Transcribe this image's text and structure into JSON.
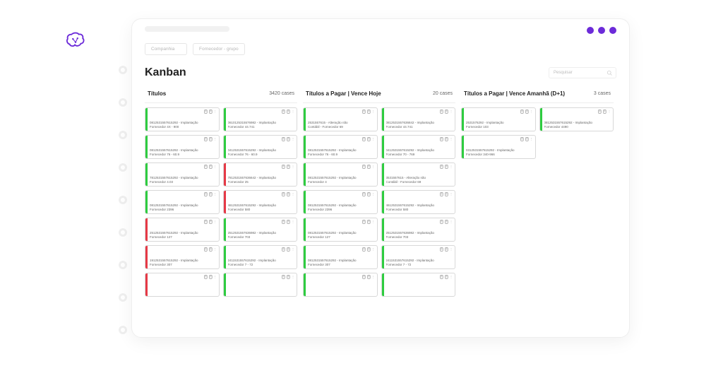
{
  "filters": {
    "companhia": "Companhia",
    "fornecedor": "Fornecedor - grupo"
  },
  "page_title": "Kanban",
  "search_placeholder": "Pesquisar",
  "columns": [
    {
      "title": "Títulos",
      "count": "3420 cases",
      "cards": [
        {
          "stripe": "green",
          "l1": "0812531557615292 - Implantação",
          "l2": "Fornecedor 4X - 900"
        },
        {
          "stripe": "green",
          "l1": "0610125315576982 - Implantação",
          "l2": "Fornecedor 44.741"
        },
        {
          "stripe": "green",
          "l1": "0812531557615292 - Implantação",
          "l2": "Fornecedor 76 - 60.9"
        },
        {
          "stripe": "green",
          "l1": "0412531557615292 - Implantação",
          "l2": "Fornecedor 76 - 60.9"
        },
        {
          "stripe": "green",
          "l1": "7812531557615292 - Implantação",
          "l2": "Fornecedor 4.03"
        },
        {
          "stripe": "red",
          "l1": "7812531557636642 - Implantação",
          "l2": "Fornecedor 25"
        },
        {
          "stripe": "green",
          "l1": "0812531557615292 - Implantação",
          "l2": "Fornecedor 2396"
        },
        {
          "stripe": "red",
          "l1": "4612531557615292 - Implantação",
          "l2": "Fornecedor 580"
        },
        {
          "stripe": "red",
          "l1": "2512531557615292 - Implantação",
          "l2": "Fornecedor 127"
        },
        {
          "stripe": "green",
          "l1": "2512531557636982 - Implantação",
          "l2": "Fornecedor 703"
        },
        {
          "stripe": "red",
          "l1": "1912531557615292 - Implantação",
          "l2": "Fornecedor 307"
        },
        {
          "stripe": "green",
          "l1": "2411531557615292 - Implantação",
          "l2": "Fornecedor 7 - 72"
        },
        {
          "stripe": "red",
          "l1": "",
          "l2": ""
        },
        {
          "stripe": "green",
          "l1": "",
          "l2": ""
        }
      ]
    },
    {
      "title": "Títulos a Pagar | Vence Hoje",
      "count": "20 cases",
      "cards": [
        {
          "stripe": "green",
          "l1": "2531557615 - Alteração não",
          "l2": "Contábil - Fornecedor 69"
        },
        {
          "stripe": "green",
          "l1": "0812531557636842 - Implantação",
          "l2": "Fornecedor 44.741"
        },
        {
          "stripe": "green",
          "l1": "0812531557615292 - Implantação",
          "l2": "Fornecedor 76 - 60.9"
        },
        {
          "stripe": "green",
          "l1": "0412531557615292 - Implantação",
          "l2": "Fornecedor 70 - 769"
        },
        {
          "stripe": "green",
          "l1": "0812531557615292 - Implantação",
          "l2": "Fornecedor 4"
        },
        {
          "stripe": "green",
          "l1": "3531557615 - Alteração não",
          "l2": "Contábil - Fornecedor 69"
        },
        {
          "stripe": "green",
          "l1": "0812531557615292 - Implantação",
          "l2": "Fornecedor 2396"
        },
        {
          "stripe": "green",
          "l1": "4612531557615292 - Implantação",
          "l2": "Fornecedor 580"
        },
        {
          "stripe": "green",
          "l1": "0812531557615292 - Implantação",
          "l2": "Fornecedor 127"
        },
        {
          "stripe": "green",
          "l1": "2512531557636982 - Implantação",
          "l2": "Fornecedor 703"
        },
        {
          "stripe": "green",
          "l1": "0812531557615292 - Implantação",
          "l2": "Fornecedor 307"
        },
        {
          "stripe": "green",
          "l1": "2411531557615292 - Implantação",
          "l2": "Fornecedor 7 - 72"
        },
        {
          "stripe": "green",
          "l1": "",
          "l2": ""
        },
        {
          "stripe": "green",
          "l1": "",
          "l2": ""
        }
      ]
    },
    {
      "title": "Títulos a Pagar | Vence Amanhã (D+1)",
      "count": "3 cases",
      "cards": [
        {
          "stripe": "green",
          "l1": "2531576292 - Implantação",
          "l2": "Fornecedor 103"
        },
        {
          "stripe": "green",
          "l1": "0812531557615292 - Implantação",
          "l2": "Fornecedor 4490"
        },
        {
          "stripe": "green",
          "l1": "0312531557615292 - Implantação",
          "l2": "Fornecedor 340-966"
        }
      ]
    }
  ]
}
